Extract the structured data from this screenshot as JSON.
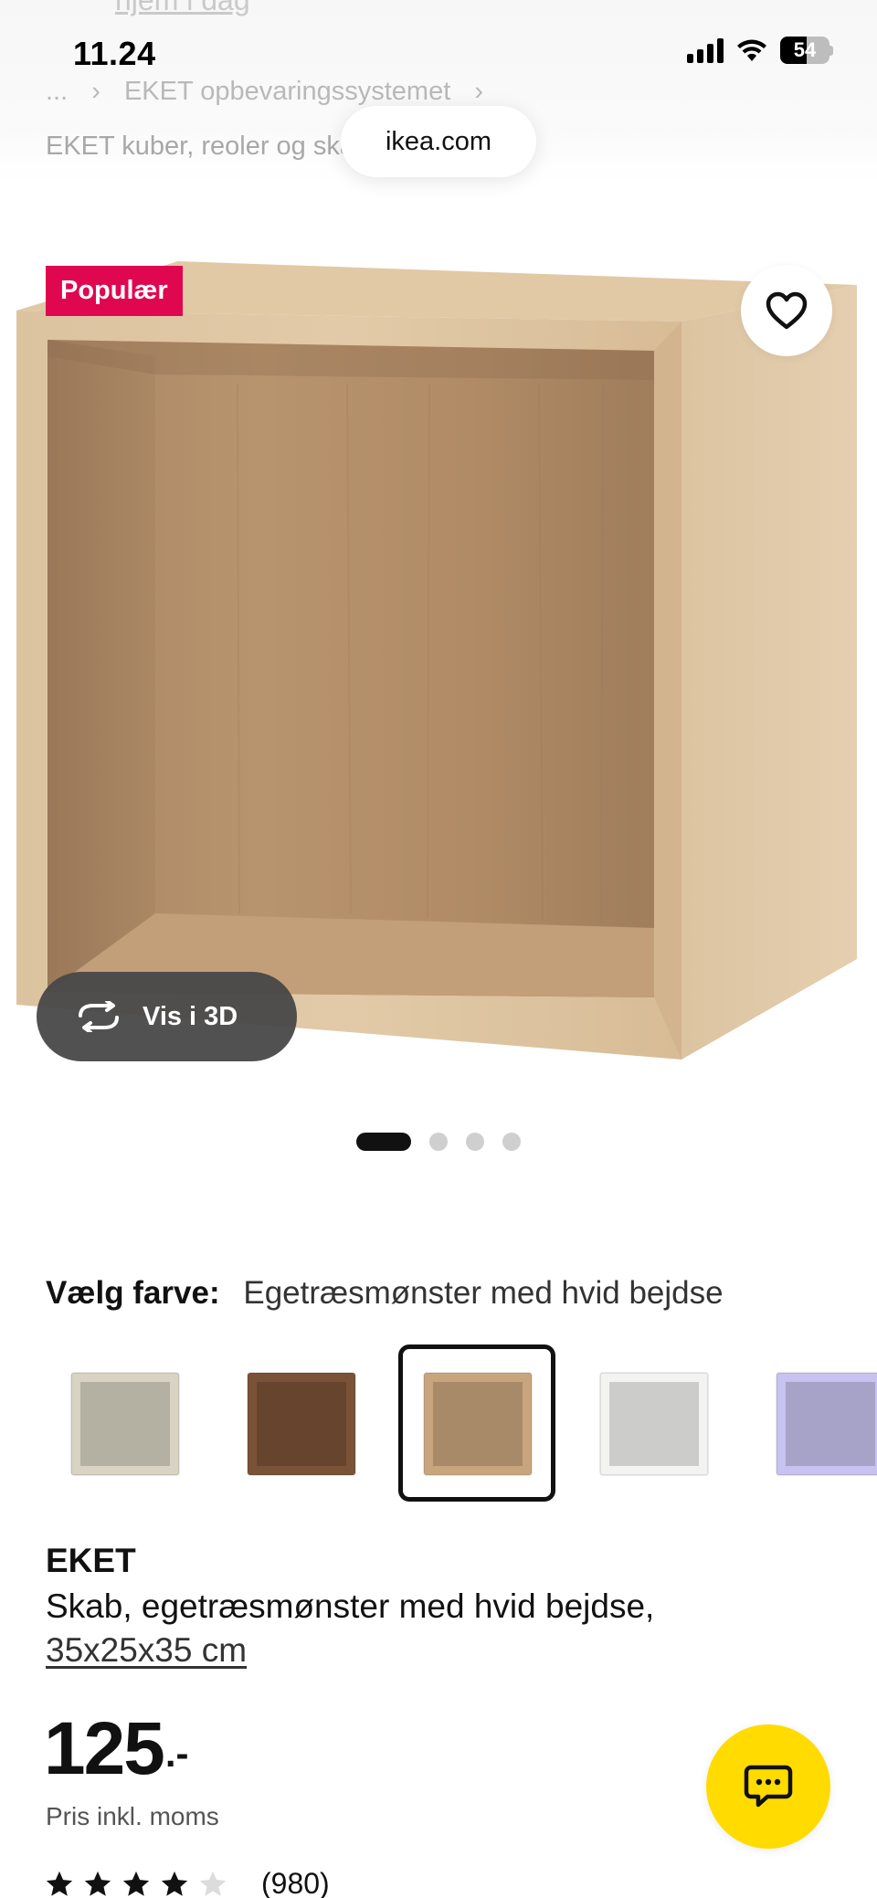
{
  "status_bar": {
    "time": "11.24",
    "battery": "54",
    "battery_level": 0.54
  },
  "top": {
    "cut_link": "hjem i dag",
    "breadcrumb": [
      "...",
      "EKET opbevaringssystemet"
    ],
    "breadcrumb_sub": "EKET kuber, reoler og skabe",
    "url": "ikea.com"
  },
  "gallery": {
    "badge": "Populær",
    "view3d_label": "Vis i 3D",
    "image_count": 4,
    "active_index": 0
  },
  "color": {
    "label": "Vælg farve:",
    "value": "Egetræsmønster med hvid bejdse",
    "swatches": [
      {
        "name": "beige",
        "color": "#d8d3c2"
      },
      {
        "name": "walnut",
        "color": "#7a5236"
      },
      {
        "name": "white-stained-oak",
        "color": "#c9a57d",
        "selected": true
      },
      {
        "name": "white",
        "color": "#f3f3f1"
      },
      {
        "name": "lilac",
        "color": "#c7c2ef"
      }
    ]
  },
  "product": {
    "name": "EKET",
    "description": "Skab, egetræsmønster med hvid bejdse,",
    "size": "35x25x35 cm",
    "price": "125",
    "price_suffix": ".-",
    "price_note": "Pris inkl. moms",
    "rating": 4,
    "rating_max": 5,
    "review_count": "(980)"
  },
  "icons": {
    "heart": "heart-icon",
    "rotate": "rotate-3d-icon",
    "chat": "chat-icon",
    "chevron": "chevron-right-icon"
  },
  "colors": {
    "badge": "#e00751",
    "chat": "#ffdb00"
  }
}
